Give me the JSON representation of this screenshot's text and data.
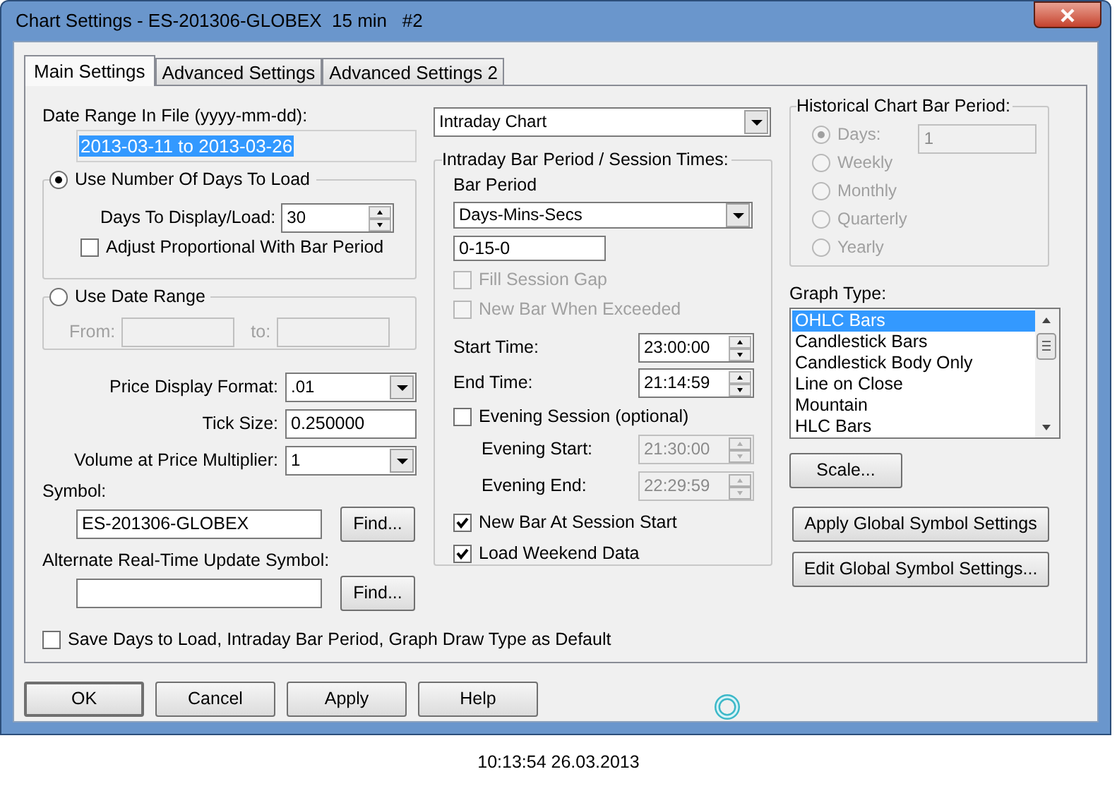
{
  "window": {
    "title": "Chart Settings - ES-201306-GLOBEX  15 min   #2"
  },
  "tabs": [
    {
      "label": "Main Settings",
      "selected": true
    },
    {
      "label": "Advanced Settings",
      "selected": false
    },
    {
      "label": "Advanced Settings 2",
      "selected": false
    }
  ],
  "date_range_in_file": {
    "label": "Date Range In File (yyyy-mm-dd):",
    "value": "2013-03-11 to 2013-03-26"
  },
  "days_to_load_group": {
    "label": "Use Number Of Days To Load",
    "selected": true,
    "days_label": "Days To Display/Load:",
    "days_value": "30",
    "adjust": {
      "label": "Adjust Proportional With Bar Period",
      "checked": false
    }
  },
  "date_range_group": {
    "label": "Use Date Range",
    "selected": false,
    "from_label": "From:",
    "to_label": "to:"
  },
  "price_display_format": {
    "label": "Price Display Format:",
    "value": ".01"
  },
  "tick_size": {
    "label": "Tick Size:",
    "value": "0.250000"
  },
  "volume_multiplier": {
    "label": "Volume at Price Multiplier:",
    "value": "1"
  },
  "symbol": {
    "label": "Symbol:",
    "value": "ES-201306-GLOBEX",
    "button": "Find..."
  },
  "alternate_symbol": {
    "label": "Alternate Real-Time Update Symbol:",
    "button": "Find..."
  },
  "save_default": {
    "label": "Save Days to Load, Intraday Bar Period, Graph Draw Type as Default",
    "checked": false
  },
  "chart_type": {
    "value": "Intraday Chart"
  },
  "intraday_group": {
    "title": "Intraday Bar Period / Session Times:",
    "bar_period_label": "Bar Period",
    "bar_period_value": "Days-Mins-Secs",
    "period_value": "0-15-0",
    "options": [
      {
        "label": "Fill Session Gap",
        "checked": false,
        "disabled": true
      },
      {
        "label": "New Bar When Exceeded",
        "checked": false,
        "disabled": true
      }
    ],
    "times": [
      {
        "label": "Start Time:",
        "value": "23:00:00",
        "disabled": false
      },
      {
        "label": "End Time:",
        "value": "21:14:59",
        "disabled": false
      }
    ],
    "evening_session": {
      "label": "Evening Session (optional)",
      "checked": false
    },
    "evening_times": [
      {
        "label": "Evening Start:",
        "value": "21:30:00",
        "disabled": true
      },
      {
        "label": "Evening End:",
        "value": "22:29:59",
        "disabled": true
      }
    ],
    "flags": [
      {
        "label": "New Bar At Session Start",
        "checked": true,
        "disabled": false
      },
      {
        "label": "Load Weekend Data",
        "checked": true,
        "disabled": false
      }
    ]
  },
  "historical_group": {
    "title": "Historical Chart Bar Period:",
    "days_value": "1",
    "periods": [
      {
        "label": "Days:",
        "selected": true,
        "disabled": true
      },
      {
        "label": "Weekly",
        "selected": false,
        "disabled": true
      },
      {
        "label": "Monthly",
        "selected": false,
        "disabled": true
      },
      {
        "label": "Quarterly",
        "selected": false,
        "disabled": true
      },
      {
        "label": "Yearly",
        "selected": false,
        "disabled": true
      }
    ]
  },
  "graph_type": {
    "label": "Graph Type:",
    "items": [
      {
        "label": "OHLC Bars",
        "selected": true
      },
      {
        "label": "Candlestick Bars",
        "selected": false
      },
      {
        "label": "Candlestick Body Only",
        "selected": false
      },
      {
        "label": "Line on Close",
        "selected": false
      },
      {
        "label": "Mountain",
        "selected": false
      },
      {
        "label": "HLC Bars",
        "selected": false
      }
    ]
  },
  "side_buttons": [
    "Scale...",
    "Apply Global Symbol Settings",
    "Edit Global Symbol Settings..."
  ],
  "dialog_buttons": [
    "OK",
    "Cancel",
    "Apply",
    "Help"
  ],
  "timestamp": "10:13:54 26.03.2013"
}
